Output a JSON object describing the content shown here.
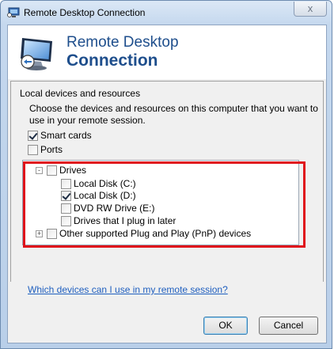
{
  "window": {
    "title": "Remote Desktop Connection",
    "close_glyph": "x"
  },
  "banner": {
    "line1": "Remote Desktop",
    "line2": "Connection",
    "logo_icon": "remote-desktop-monitor-icon"
  },
  "panel": {
    "title": "Local devices and resources",
    "description_line1": "Choose the devices and resources on this computer that you want to",
    "description_line2": "use in your remote session.",
    "options": [
      {
        "label": "Smart cards",
        "checked": true
      },
      {
        "label": "Ports",
        "checked": false
      }
    ]
  },
  "tree": {
    "drives": {
      "label": "Drives",
      "expander": "-",
      "checked": false
    },
    "drive_items": [
      {
        "label": "Local Disk (C:)",
        "checked": false
      },
      {
        "label": "Local Disk (D:)",
        "checked": true
      },
      {
        "label": "DVD RW Drive (E:)",
        "checked": false
      },
      {
        "label": "Drives that I plug in later",
        "checked": false
      }
    ],
    "pnp": {
      "label": "Other supported Plug and Play (PnP) devices",
      "expander": "+",
      "checked": false
    }
  },
  "help_link": "Which devices can I use in my remote session?",
  "buttons": {
    "ok": "OK",
    "cancel": "Cancel"
  },
  "colors": {
    "highlight_box": "#e0121b",
    "banner_text": "#1e4e8c",
    "link": "#1f5fbf"
  }
}
